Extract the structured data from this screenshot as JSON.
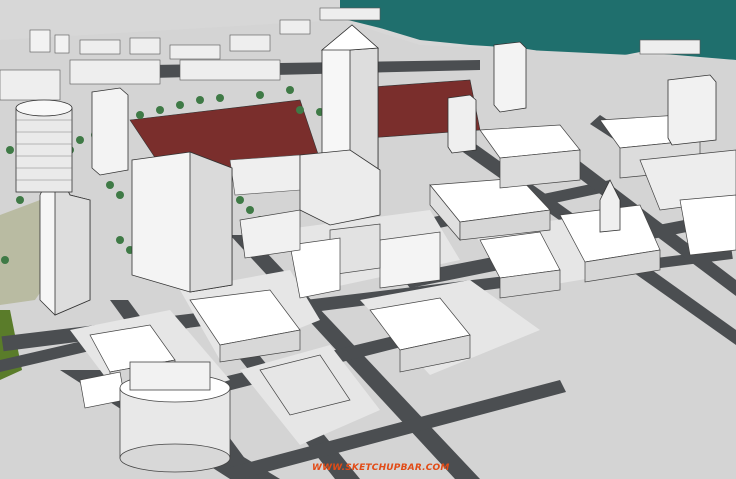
{
  "watermark": {
    "text": "WWW.SKETCHUPBAR.COM"
  },
  "colors": {
    "sky": "#b8bfc6",
    "water": "#1f6f6d",
    "ground": "#d6d6d6",
    "road": "#4a4d50",
    "building_top": "#ffffff",
    "building_side": "#e4e4e4",
    "building_shadow": "#c8c8c8",
    "red_roofs": "#7a2e2c",
    "trees": "#3f7a46",
    "grass": "#b7b9a0",
    "park": "#5a7c2a",
    "watermark": "#e24b16"
  }
}
